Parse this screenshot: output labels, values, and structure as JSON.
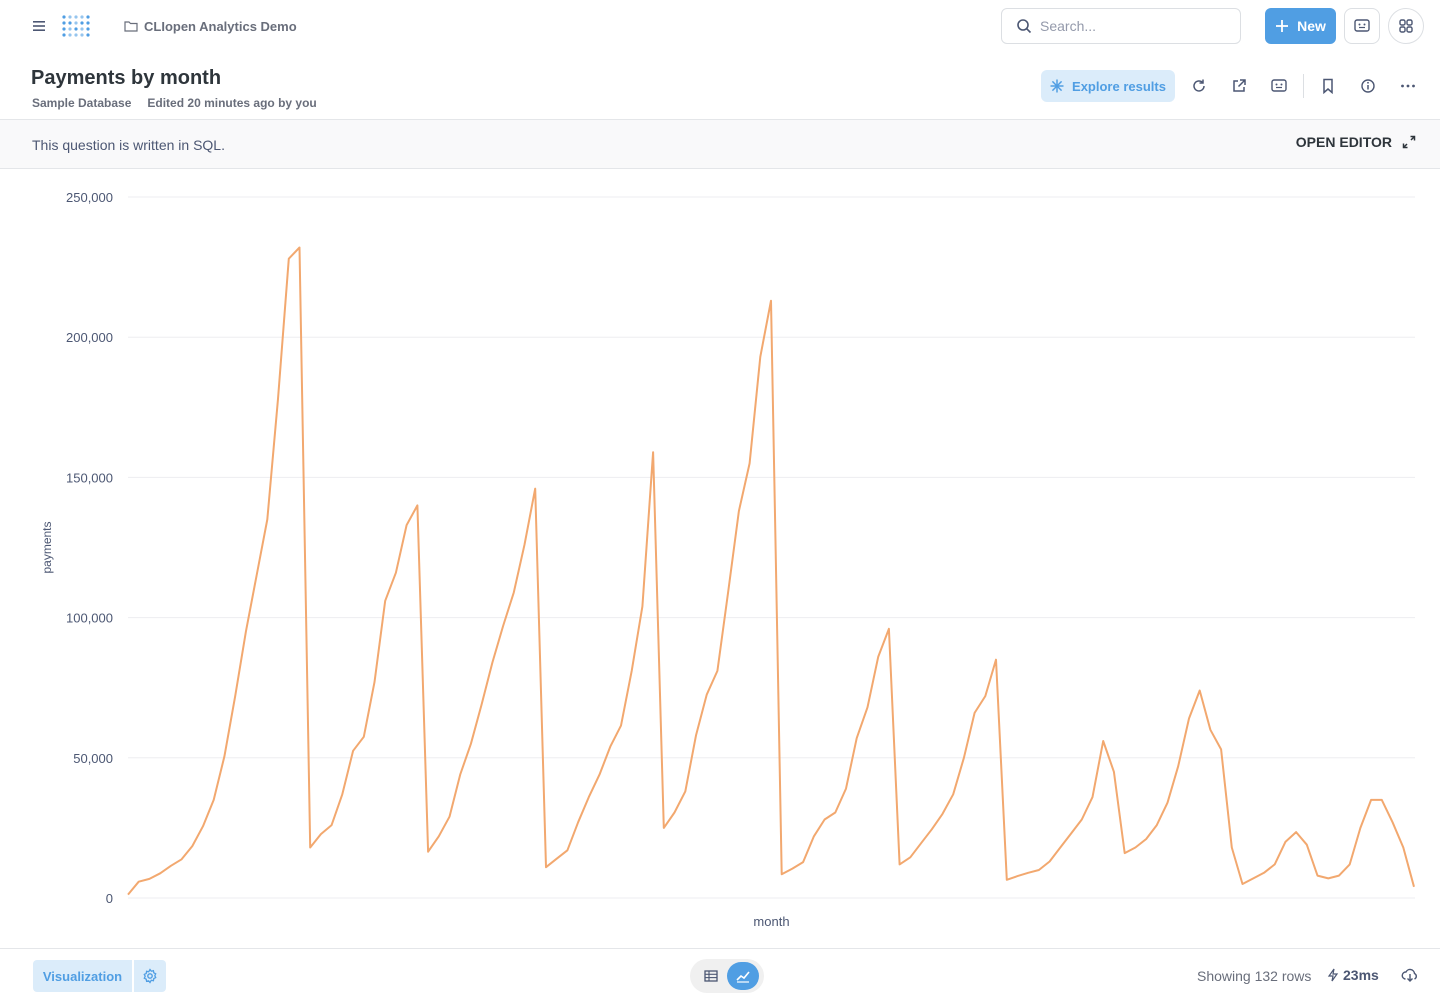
{
  "nav": {
    "collection": "CLIopen Analytics Demo",
    "search_placeholder": "Search...",
    "new_label": "New"
  },
  "header": {
    "title": "Payments by month",
    "database": "Sample Database",
    "edited": "Edited 20 minutes ago by you",
    "explore_label": "Explore results"
  },
  "sql_banner": {
    "text": "This question is written in SQL.",
    "open_editor": "OPEN EDITOR"
  },
  "footer": {
    "visualization_label": "Visualization",
    "rows_text": "Showing 132 rows",
    "timing": "23ms"
  },
  "colors": {
    "accent": "#509ee3",
    "series": "#f2a86f"
  },
  "chart_data": {
    "type": "line",
    "xlabel": "month",
    "ylabel": "payments",
    "ylim": [
      0,
      250000
    ],
    "yticks": [
      "0",
      "50,000",
      "100,000",
      "150,000",
      "200,000",
      "250,000"
    ],
    "grid": true,
    "series": [
      {
        "values": [
          1200,
          5800,
          6800,
          8800,
          11500,
          13800,
          18500,
          25600,
          35000,
          50500,
          72000,
          95000,
          115000,
          135000,
          178000,
          228000,
          232000,
          18000,
          22800,
          26000,
          37000,
          52500,
          57500,
          77000,
          106000,
          116000,
          133000,
          140000,
          16500,
          22000,
          29000,
          44000,
          55000,
          69000,
          84000,
          97000,
          109000,
          126000,
          146000,
          11000,
          14000,
          17000,
          27000,
          36000,
          44000,
          54000,
          61500,
          81000,
          104000,
          159000,
          25000,
          30500,
          38000,
          58000,
          72500,
          81000,
          109000,
          138000,
          155000,
          193000,
          213000,
          8500,
          10500,
          12800,
          22000,
          28000,
          30500,
          39000,
          57000,
          68000,
          86000,
          96000,
          12000,
          14500,
          19500,
          24500,
          30000,
          37000,
          50000,
          66000,
          72000,
          85000,
          6500,
          7800,
          9000,
          10000,
          13000,
          18000,
          23000,
          28000,
          36000,
          56000,
          45000,
          16000,
          18000,
          21000,
          26000,
          34000,
          47000,
          64000,
          74000,
          60000,
          53000,
          18000,
          5000,
          7000,
          9000,
          12000,
          20000,
          23500,
          19000,
          8000,
          7000,
          8000,
          12000,
          25000,
          35000,
          35000,
          27000,
          18000,
          4000
        ]
      }
    ]
  }
}
